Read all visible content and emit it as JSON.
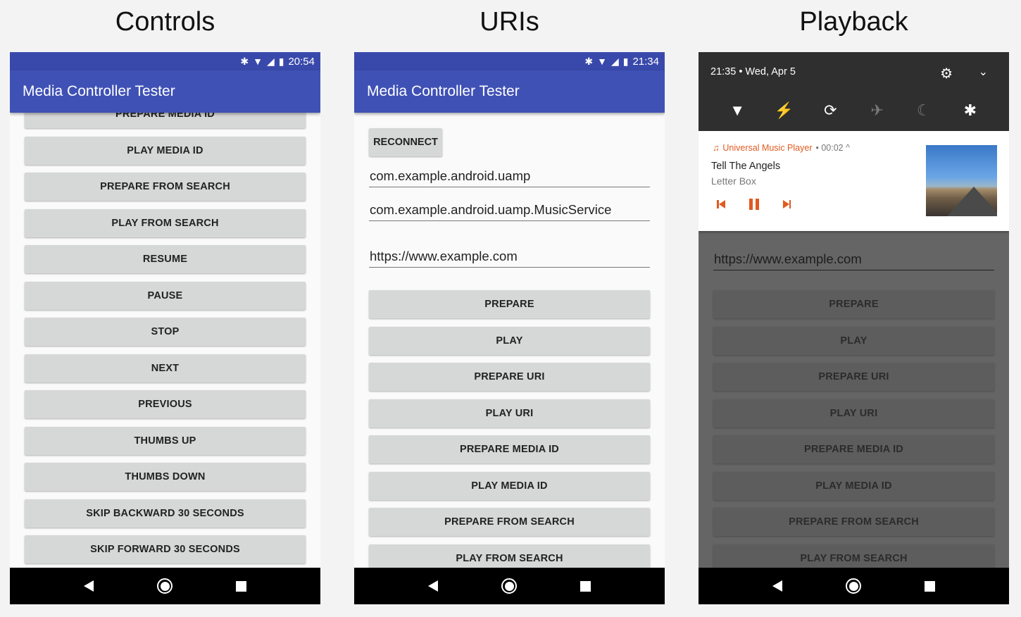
{
  "headings": {
    "controls": "Controls",
    "uris": "URIs",
    "playback": "Playback"
  },
  "status1": {
    "time": "20:54"
  },
  "status2": {
    "time": "21:34"
  },
  "app": {
    "title": "Media Controller Tester"
  },
  "controls_buttons": [
    "PREPARE MEDIA ID",
    "PLAY MEDIA ID",
    "PREPARE FROM SEARCH",
    "PLAY FROM SEARCH",
    "RESUME",
    "PAUSE",
    "STOP",
    "NEXT",
    "PREVIOUS",
    "THUMBS UP",
    "THUMBS DOWN",
    "SKIP BACKWARD 30 SECONDS",
    "SKIP FORWARD 30 SECONDS"
  ],
  "uris": {
    "reconnect": "RECONNECT",
    "package_field": "com.example.android.uamp",
    "service_field": "com.example.android.uamp.MusicService",
    "uri_field": "https://www.example.com",
    "buttons": [
      "PREPARE",
      "PLAY",
      "PREPARE URI",
      "PLAY URI",
      "PREPARE MEDIA ID",
      "PLAY MEDIA ID",
      "PREPARE FROM SEARCH",
      "PLAY FROM SEARCH"
    ]
  },
  "quick_settings": {
    "time_date": "21:35 • Wed, Apr 5"
  },
  "notification": {
    "app_name": "Universal Music Player",
    "meta": "• 00:02 ^",
    "title": "Tell The Angels",
    "subtitle": "Letter Box"
  },
  "playback": {
    "uri_field": "https://www.example.com",
    "buttons": [
      "PREPARE",
      "PLAY",
      "PREPARE URI",
      "PLAY URI",
      "PREPARE MEDIA ID",
      "PLAY MEDIA ID",
      "PREPARE FROM SEARCH",
      "PLAY FROM SEARCH"
    ]
  },
  "icons": {
    "statusbar": [
      "bluetooth-icon",
      "wifi-icon",
      "signal-icon",
      "battery-icon"
    ],
    "nav": [
      "back-icon",
      "home-icon",
      "recents-icon"
    ],
    "quick_tiles": [
      "wifi-icon",
      "flashlight-icon",
      "auto-rotate-icon",
      "airplane-mode-icon",
      "do-not-disturb-icon",
      "bluetooth-icon"
    ]
  },
  "colors": {
    "app_bar": "#3f51b5",
    "status_bar": "#3949ab",
    "notification_accent": "#e05a1f",
    "button": "#d6d7d7"
  }
}
